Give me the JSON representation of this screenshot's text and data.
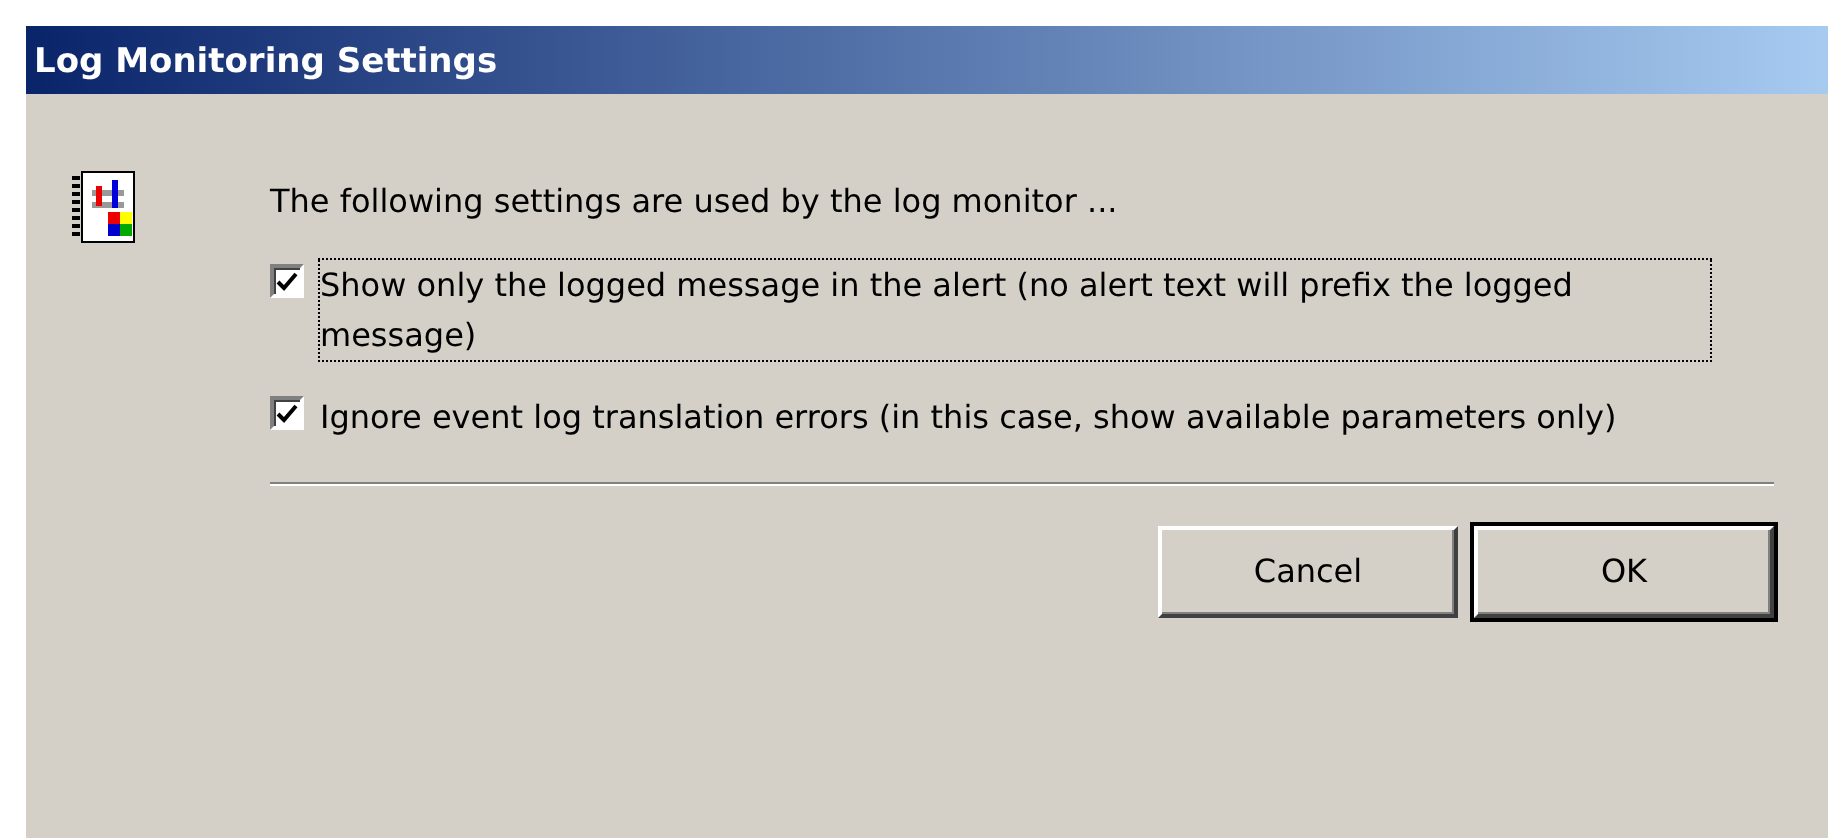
{
  "window": {
    "title": "Log Monitoring Settings"
  },
  "intro": "The following settings are used by the log monitor ...",
  "options": [
    {
      "label": "Show only the logged message in the alert (no alert text will prefix the logged message)",
      "checked": true,
      "focused": true
    },
    {
      "label": "Ignore event log translation errors (in this case, show available parameters only)",
      "checked": true,
      "focused": false
    }
  ],
  "buttons": [
    {
      "label": "Cancel",
      "default": false
    },
    {
      "label": "OK",
      "default": true
    }
  ]
}
